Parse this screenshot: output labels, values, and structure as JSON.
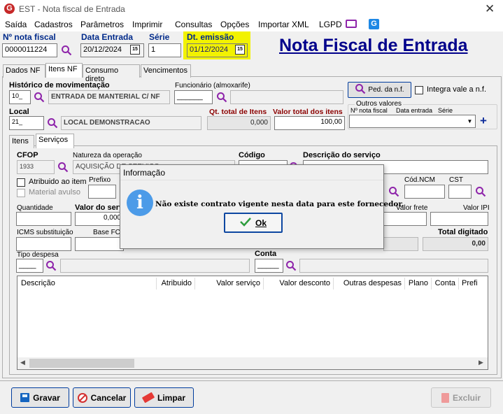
{
  "window": {
    "title": "EST - Nota fiscal de Entrada",
    "close": "✕",
    "app_badge": "G"
  },
  "menu": {
    "items": [
      "Saída",
      "Cadastros",
      "Parâmetros",
      "Imprimir",
      "Consultas",
      "Opções",
      "Importar XML",
      "LGPD"
    ]
  },
  "header": {
    "nota_label": "Nº nota fiscal",
    "nota_value": "0000011224",
    "data_entrada_label": "Data Entrada",
    "data_entrada_value": "20/12/2024",
    "serie_label": "Série",
    "serie_value": "1",
    "dt_emissao_label": "Dt. emissão",
    "dt_emissao_value": "01/12/2024",
    "calendar_glyph": "15",
    "page_title": "Nota Fiscal de Entrada"
  },
  "tabs": {
    "top": [
      "Dados NF",
      "Itens NF",
      "Consumo direto",
      "Vencimentos"
    ],
    "sub": [
      "Itens",
      "Serviços"
    ]
  },
  "itens_nf": {
    "historico_label": "Histórico de movimentação",
    "historico_code": "10_",
    "historico_desc": "ENTRADA DE MANTERIAL C/ NF",
    "funcionario_label": "Funcionário (almoxarife)",
    "funcionario_code": "______",
    "ped_label": "Ped. da n.f.",
    "integra_label": "Integra vale a n.f.",
    "local_label": "Local",
    "local_code": "21_",
    "local_desc": "LOCAL DEMONSTRACAO",
    "qt_total_label": "Qt. total de Itens",
    "qt_total_value": "0,000",
    "valor_total_label": "Valor total dos itens",
    "valor_total_value": "100,00",
    "outros_label": "Outros valores",
    "outros_col1": "Nº nota fiscal",
    "outros_col2": "Data entrada",
    "outros_col3": "Série",
    "add_glyph": "+"
  },
  "servicos": {
    "cfop_label": "CFOP",
    "cfop_value": "1933",
    "natureza_label": "Natureza da operação",
    "natureza_value": "AQUISIÇÃO DE SERVIÇO",
    "codigo_label": "Código",
    "descricao_label": "Descrição do serviço",
    "atribuido_label": "Atribuido ao item",
    "prefixo_label": "Prefixo",
    "material_label": "Material avulso",
    "cod_ncm_label": "Cód.NCM",
    "cst_label": "CST",
    "quantidade_label": "Quantidade",
    "valor_servico_label": "Valor do serviço",
    "valor_servico_value": "0,000",
    "valor_frete_label": "Valor frete",
    "valor_ipi_label": "Valor IPI",
    "icms_label": "ICMS substituição",
    "base_fcp_label": "Base FCP",
    "total_digitado_label": "Total digitado",
    "total_digitado_value": "0,00",
    "tipo_despesa_label": "Tipo despesa",
    "tipo_code": "____",
    "conta_label": "Conta",
    "conta_code": "_____"
  },
  "table": {
    "columns": [
      "Descrição",
      "Atribuido",
      "Valor serviço",
      "Valor desconto",
      "Outras despesas",
      "Plano",
      "Conta",
      "Prefi"
    ]
  },
  "dialog": {
    "title": "Informação",
    "message": "Não existe contrato vigente nesta data para este fornecedor.",
    "ok_label": "Ok",
    "info_glyph": "i"
  },
  "footer": {
    "gravar": "Gravar",
    "cancelar": "Cancelar",
    "limpar": "Limpar",
    "excluir": "Excluir"
  }
}
